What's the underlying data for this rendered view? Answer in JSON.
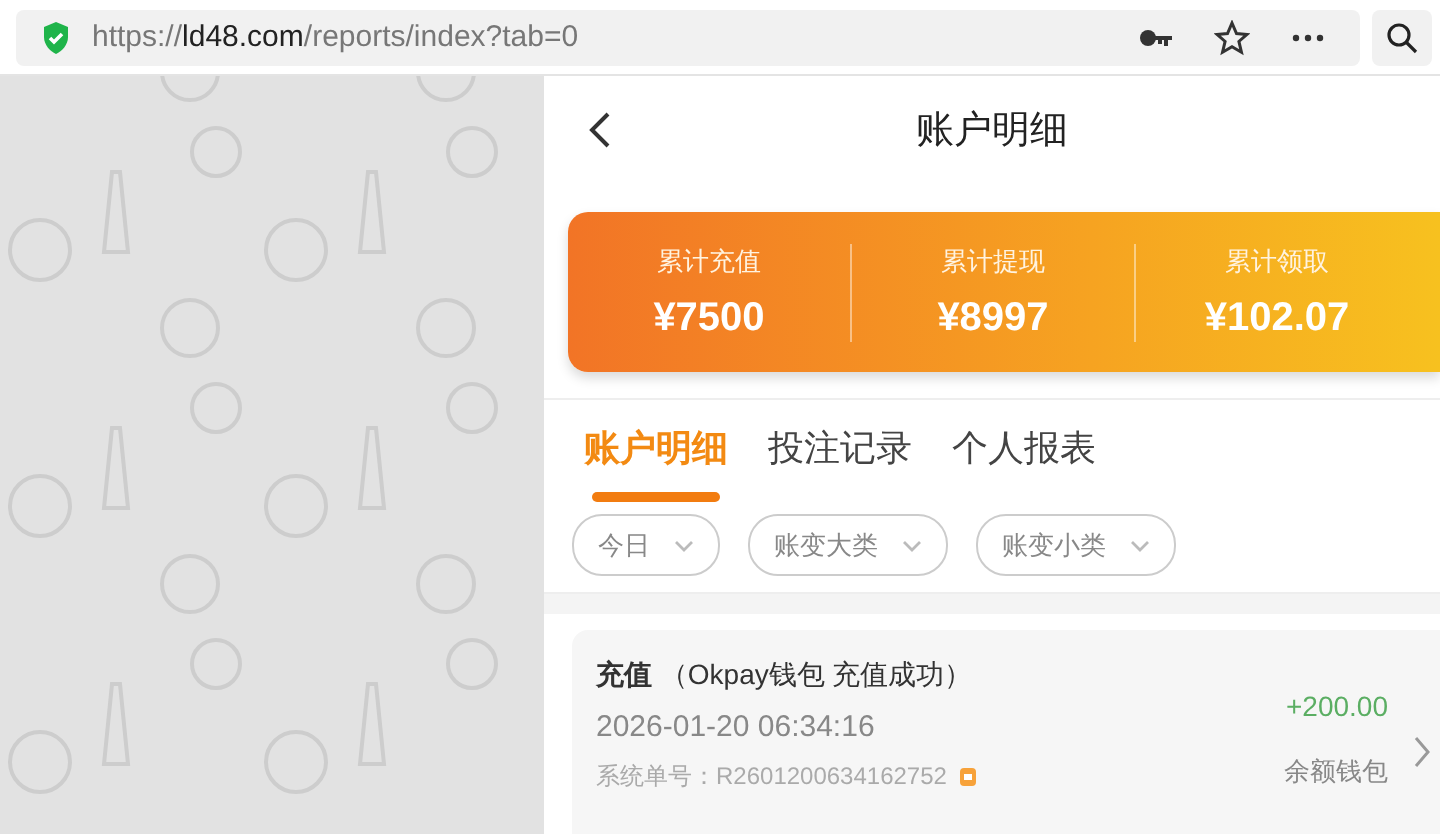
{
  "address_bar": {
    "scheme": "https://",
    "host": "ld48.com",
    "path": "/reports/index?tab=0"
  },
  "header": {
    "title": "账户明细"
  },
  "summary": [
    {
      "label": "累计充值",
      "value": "¥7500"
    },
    {
      "label": "累计提现",
      "value": "¥8997"
    },
    {
      "label": "累计领取",
      "value": "¥102.07"
    }
  ],
  "tabs": [
    {
      "label": "账户明细",
      "selected": true
    },
    {
      "label": "投注记录",
      "selected": false
    },
    {
      "label": "个人报表",
      "selected": false
    }
  ],
  "filters": [
    {
      "label": "今日"
    },
    {
      "label": "账变大类"
    },
    {
      "label": "账变小类"
    }
  ],
  "records": [
    {
      "type": "充值",
      "detail": "（Okpay钱包 充值成功）",
      "time": "2026-01-20 06:34:16",
      "order_label": "系统单号：",
      "order_no": "R2601200634162752",
      "amount": "+200.00",
      "positive": true,
      "wallet": "余额钱包"
    }
  ]
}
